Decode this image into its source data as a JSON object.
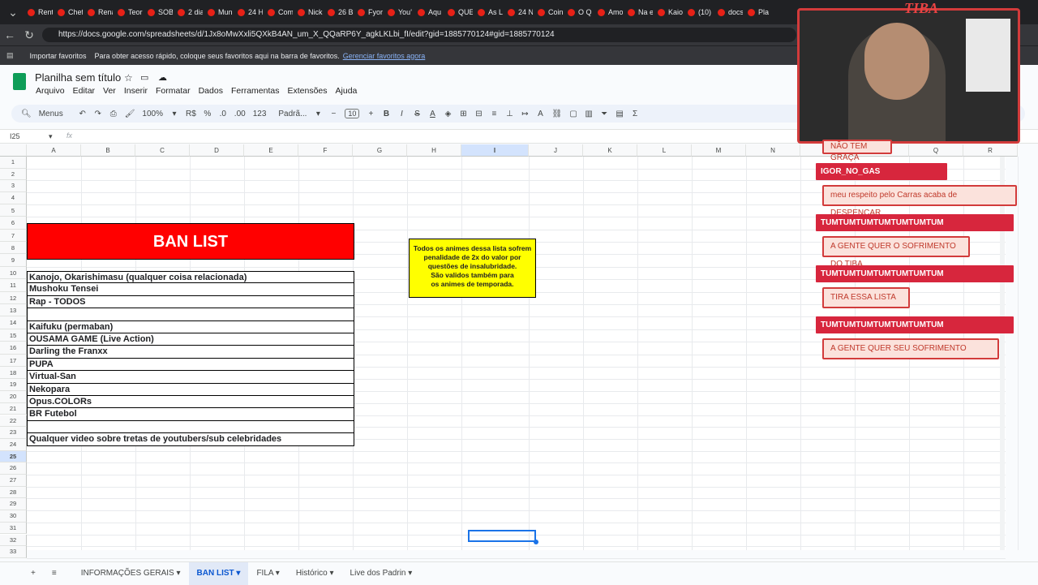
{
  "browser": {
    "tabs": [
      "Rent",
      "Chef",
      "Rena",
      "Teor",
      "SOBI",
      "2 dia",
      "Mun",
      "24 H",
      "Com",
      "Nick",
      "26 B",
      "Fyor",
      "You'",
      "Aqu",
      "QUE",
      "As L",
      "24 N",
      "Coin",
      "O Q",
      "Amo",
      "Na e",
      "Kaio",
      "(10)",
      "docs",
      "Pla"
    ],
    "url": "https://docs.google.com/spreadsheets/d/1Jx8oMwXxli5QXkB4AN_um_X_QQaRP6Y_agkLKLbi_fI/edit?gid=1885770124#gid=1885770124",
    "bookmarks_import": "Importar favoritos",
    "bookmarks_hint": "Para obter acesso rápido, coloque seus favoritos aqui na barra de favoritos.",
    "bookmarks_link": "Gerenciar favoritos agora"
  },
  "sheet": {
    "title": "Planilha sem título",
    "menus": [
      "Arquivo",
      "Editar",
      "Ver",
      "Inserir",
      "Formatar",
      "Dados",
      "Ferramentas",
      "Extensões",
      "Ajuda"
    ],
    "toolbar": {
      "search": "Menus",
      "zoom": "100%",
      "currency": "R$",
      "percent": "%",
      "dec_less": ".0",
      "dec_more": ".00",
      "format_num": "123",
      "font": "Padrã...",
      "font_size": "10"
    },
    "cell_ref": "I25",
    "fx": "fx",
    "columns": [
      "A",
      "B",
      "C",
      "D",
      "E",
      "F",
      "G",
      "H",
      "I",
      "J",
      "K",
      "L",
      "M",
      "N",
      "O",
      "P",
      "Q",
      "R"
    ],
    "rows": [
      "1",
      "2",
      "3",
      "4",
      "5",
      "6",
      "7",
      "8",
      "9",
      "10",
      "11",
      "12",
      "13",
      "14",
      "15",
      "16",
      "17",
      "18",
      "19",
      "20",
      "21",
      "22",
      "23",
      "24",
      "25",
      "26",
      "27",
      "28",
      "29",
      "30",
      "31",
      "32",
      "33"
    ],
    "ban_title": "BAN LIST",
    "note_lines": [
      "Todos os animes dessa lista sofrem",
      "penalidade de 2x do valor por",
      "questões de insalubridade.",
      "São validos também para",
      "os animes de temporada."
    ],
    "items": [
      "Kanojo, Okarishimasu (qualquer coisa relacionada)",
      "Mushoku Tensei",
      "Rap - TODOS",
      "",
      "Kaifuku (permaban)",
      "OUSAMA GAME (Live Action)",
      "Darling the Franxx",
      "PUPA",
      "Virtual-San",
      "Nekopara",
      "Opus.COLORs",
      "BR Futebol",
      "",
      "Qualquer video sobre tretas de youtubers/sub celebridades"
    ],
    "sheet_tabs": [
      "INFORMAÇÕES GERAIS",
      "BAN LIST",
      "FILA",
      "Histórico",
      "Live dos Padrin"
    ],
    "active_tab": "BAN LIST"
  },
  "overlay": {
    "cam_title": "TIBA",
    "chat": [
      {
        "type": "msg",
        "text": "NÃO TEM GRAÇA"
      },
      {
        "type": "name",
        "text": "IGOR_NO_GAS"
      },
      {
        "type": "msg",
        "text": "meu respeito pelo Carras acaba de DESPENCAR"
      },
      {
        "type": "name",
        "text": "TUMTUMTUMTUMTUMTUMTUM"
      },
      {
        "type": "msg",
        "text": "A GENTE QUER O SOFRIMENTO DO TIBA"
      },
      {
        "type": "name",
        "text": "TUMTUMTUMTUMTUMTUMTUM"
      },
      {
        "type": "msg",
        "text": "TIRA ESSA LISTA"
      },
      {
        "type": "name",
        "text": "TUMTUMTUMTUMTUMTUMTUM"
      },
      {
        "type": "msg",
        "text": "A GENTE QUER SEU SOFRIMENTO"
      }
    ]
  }
}
